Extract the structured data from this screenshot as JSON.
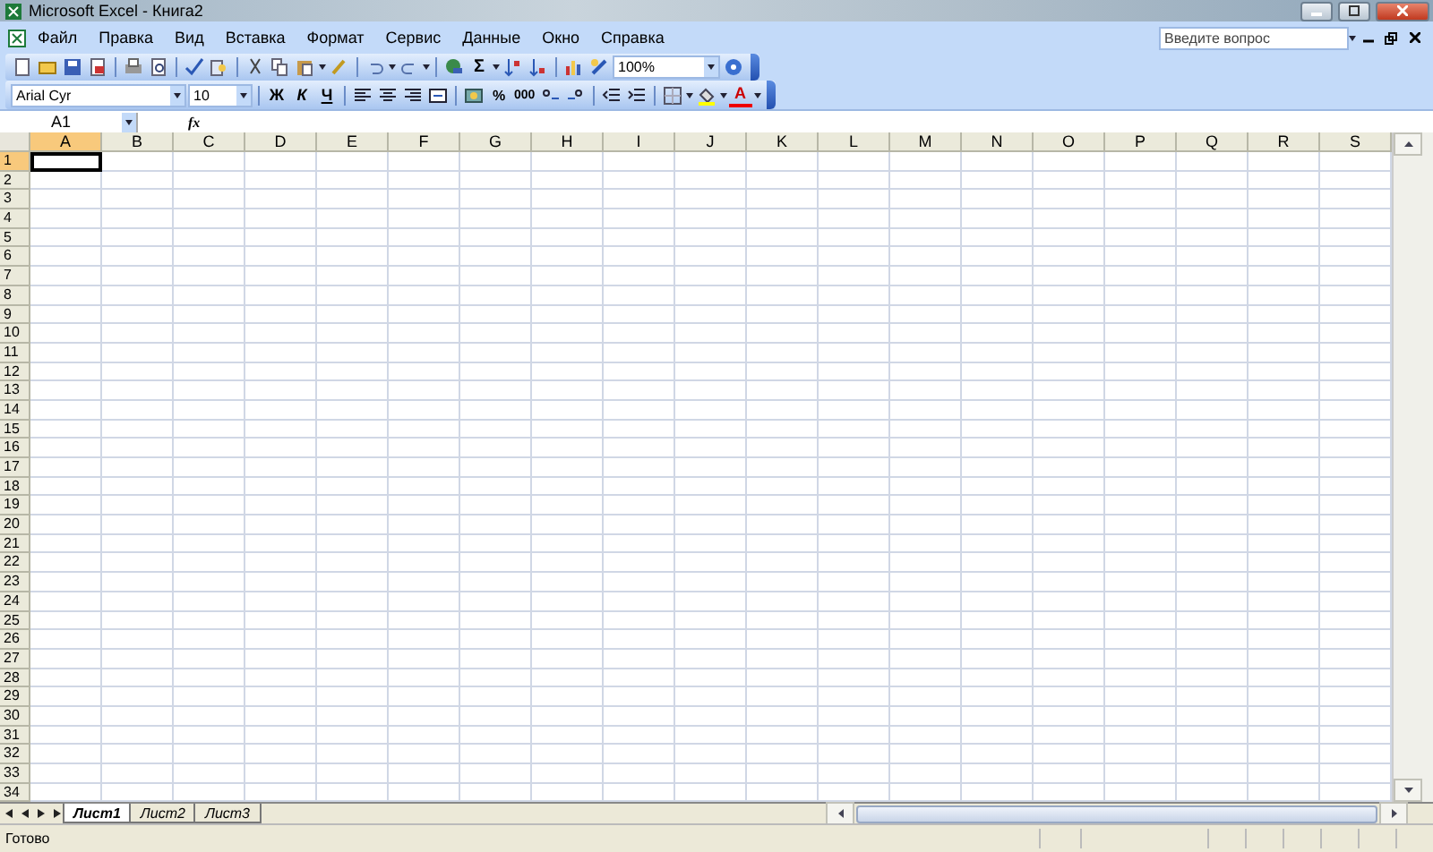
{
  "window": {
    "title": "Microsoft Excel - Книга2"
  },
  "menu": [
    {
      "label": "Файл"
    },
    {
      "label": "Правка"
    },
    {
      "label": "Вид"
    },
    {
      "label": "Вставка"
    },
    {
      "label": "Формат"
    },
    {
      "label": "Сервис"
    },
    {
      "label": "Данные"
    },
    {
      "label": "Окно"
    },
    {
      "label": "Справка"
    }
  ],
  "help_search": {
    "placeholder": "Введите вопрос"
  },
  "standard_toolbar": {
    "autosum": "Σ",
    "zoom": "100%"
  },
  "formatting_toolbar": {
    "font": "Arial Cyr",
    "size": "10",
    "bold": "Ж",
    "italic": "К",
    "underline": "Ч",
    "percent": "%",
    "thousands": "000",
    "font_color": "A"
  },
  "formula_bar": {
    "name_box": "A1",
    "function_label": "fx"
  },
  "sheet": {
    "columns": [
      {
        "label": "A",
        "selected": true
      },
      {
        "label": "B",
        "selected": false
      },
      {
        "label": "C",
        "selected": false
      },
      {
        "label": "D",
        "selected": false
      },
      {
        "label": "E",
        "selected": false
      },
      {
        "label": "F",
        "selected": false
      },
      {
        "label": "G",
        "selected": false
      },
      {
        "label": "H",
        "selected": false
      },
      {
        "label": "I",
        "selected": false
      },
      {
        "label": "J",
        "selected": false
      },
      {
        "label": "K",
        "selected": false
      },
      {
        "label": "L",
        "selected": false
      },
      {
        "label": "M",
        "selected": false
      },
      {
        "label": "N",
        "selected": false
      },
      {
        "label": "O",
        "selected": false
      },
      {
        "label": "P",
        "selected": false
      },
      {
        "label": "Q",
        "selected": false
      },
      {
        "label": "R",
        "selected": false
      },
      {
        "label": "S",
        "selected": false
      }
    ],
    "rows": [
      {
        "label": "1",
        "selected": true
      },
      {
        "label": "2",
        "selected": false
      },
      {
        "label": "3",
        "selected": false
      },
      {
        "label": "4",
        "selected": false
      },
      {
        "label": "5",
        "selected": false
      },
      {
        "label": "6",
        "selected": false
      },
      {
        "label": "7",
        "selected": false
      },
      {
        "label": "8",
        "selected": false
      },
      {
        "label": "9",
        "selected": false
      },
      {
        "label": "10",
        "selected": false
      },
      {
        "label": "11",
        "selected": false
      },
      {
        "label": "12",
        "selected": false
      },
      {
        "label": "13",
        "selected": false
      },
      {
        "label": "14",
        "selected": false
      },
      {
        "label": "15",
        "selected": false
      },
      {
        "label": "16",
        "selected": false
      },
      {
        "label": "17",
        "selected": false
      },
      {
        "label": "18",
        "selected": false
      },
      {
        "label": "19",
        "selected": false
      },
      {
        "label": "20",
        "selected": false
      },
      {
        "label": "21",
        "selected": false
      },
      {
        "label": "22",
        "selected": false
      },
      {
        "label": "23",
        "selected": false
      },
      {
        "label": "24",
        "selected": false
      },
      {
        "label": "25",
        "selected": false
      },
      {
        "label": "26",
        "selected": false
      },
      {
        "label": "27",
        "selected": false
      },
      {
        "label": "28",
        "selected": false
      },
      {
        "label": "29",
        "selected": false
      },
      {
        "label": "30",
        "selected": false
      },
      {
        "label": "31",
        "selected": false
      },
      {
        "label": "32",
        "selected": false
      },
      {
        "label": "33",
        "selected": false
      },
      {
        "label": "34",
        "selected": false
      }
    ]
  },
  "sheet_tabs": [
    {
      "label": "Лист1",
      "selected": true
    },
    {
      "label": "Лист2",
      "selected": false
    },
    {
      "label": "Лист3",
      "selected": false
    }
  ],
  "status_bar": {
    "text": "Готово"
  }
}
